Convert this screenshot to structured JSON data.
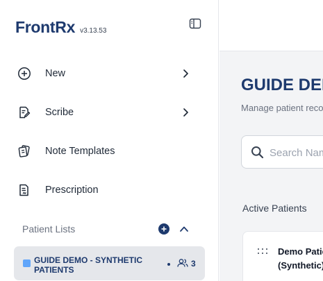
{
  "brand": {
    "name": "FrontRx",
    "version": "v3.13.53"
  },
  "sidebar": {
    "nav": [
      {
        "label": "New",
        "icon": "plus-circle-icon",
        "has_submenu": true
      },
      {
        "label": "Scribe",
        "icon": "document-pen-icon",
        "has_submenu": true
      },
      {
        "label": "Note Templates",
        "icon": "cards-icon",
        "has_submenu": false
      },
      {
        "label": "Prescription",
        "icon": "prescription-icon",
        "has_submenu": false
      }
    ],
    "patient_lists": {
      "title": "Patient Lists",
      "items": [
        {
          "name": "GUIDE DEMO - SYNTHETIC PATIENTS",
          "count": "3",
          "color": "#60a5fa"
        }
      ]
    }
  },
  "main": {
    "title": "GUIDE DEMO - SYNTHETIC PATIENTS",
    "subtitle": "Manage patient records",
    "search": {
      "placeholder": "Search Name"
    },
    "active_label": "Active Patients",
    "patients": [
      {
        "name": "Demo Patient (Synthetic)"
      }
    ]
  },
  "colors": {
    "brand": "#1e3a6e",
    "accent": "#60a5fa",
    "main_bg": "#f3f4f6"
  }
}
